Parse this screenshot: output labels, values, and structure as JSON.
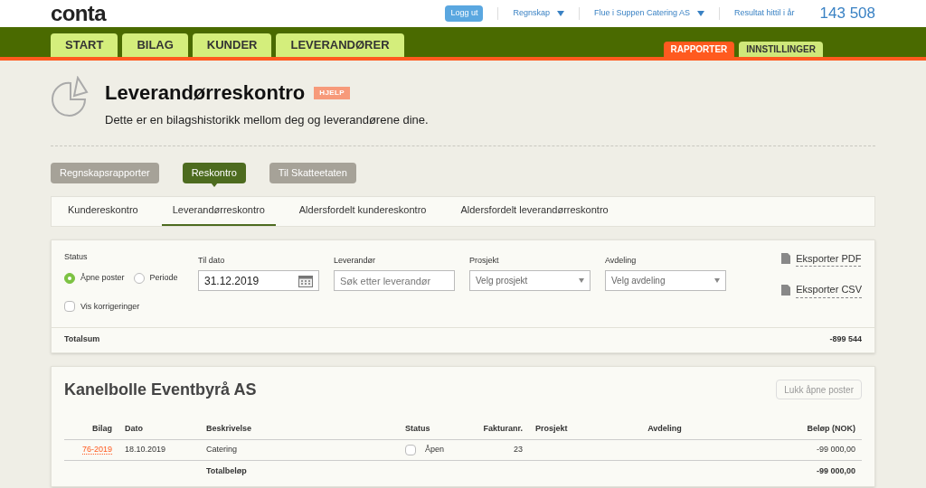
{
  "logo": "conta",
  "top_links": [
    {
      "label": "Logg ut",
      "kind": "button"
    },
    {
      "label": "Regnskap",
      "kind": "dropdown"
    },
    {
      "label": "Flue i Suppen Catering AS",
      "kind": "dropdown"
    },
    {
      "label": "Resultat hittil i år",
      "kind": "link"
    }
  ],
  "result_value": "143 508",
  "main_tabs": [
    {
      "label": "START"
    },
    {
      "label": "BILAG"
    },
    {
      "label": "KUNDER"
    },
    {
      "label": "LEVERANDØRER"
    }
  ],
  "right_tabs": [
    {
      "label": "RAPPORTER",
      "selected": true
    },
    {
      "label": "INNSTILLINGER",
      "selected": false
    }
  ],
  "page": {
    "title": "Leverandørreskontro",
    "help": "HJELP",
    "subtitle": "Dette er en bilagshistorikk mellom deg og leverandørene dine."
  },
  "sub_buttons": [
    {
      "label": "Regnskapsrapporter",
      "selected": false
    },
    {
      "label": "Reskontro",
      "selected": true
    },
    {
      "label": "Til Skatteetaten",
      "selected": false
    }
  ],
  "report_tabs": [
    {
      "label": "Kundereskontro",
      "selected": false
    },
    {
      "label": "Leverandørreskontro",
      "selected": true
    },
    {
      "label": "Aldersfordelt kundereskontro",
      "selected": false
    },
    {
      "label": "Aldersfordelt leverandørreskontro",
      "selected": false
    }
  ],
  "filters": {
    "status_label": "Status",
    "status_options": [
      {
        "label": "Åpne poster",
        "selected": true
      },
      {
        "label": "Periode",
        "selected": false
      }
    ],
    "show_corrections": {
      "label": "Vis korrigeringer",
      "checked": false
    },
    "date": {
      "label": "Til dato",
      "value": "31.12.2019"
    },
    "supplier": {
      "label": "Leverandør",
      "placeholder": "Søk etter leverandør"
    },
    "project": {
      "label": "Prosjekt",
      "placeholder": "Velg prosjekt"
    },
    "department": {
      "label": "Avdeling",
      "placeholder": "Velg avdeling"
    },
    "exports": [
      {
        "label": "Eksporter PDF"
      },
      {
        "label": "Eksporter CSV"
      }
    ],
    "total_label": "Totalsum",
    "total_value": "-899 544"
  },
  "supplier_card": {
    "name": "Kanelbolle Eventbyrå AS",
    "close_button": "Lukk åpne poster",
    "columns": [
      "Bilag",
      "Dato",
      "Beskrivelse",
      "Status",
      "Fakturanr.",
      "Prosjekt",
      "Avdeling",
      "Beløp (NOK)"
    ],
    "rows": [
      {
        "bilag": "76-2019",
        "dato": "18.10.2019",
        "beskrivelse": "Catering",
        "status": "Åpen",
        "checked": false,
        "fakturanr": "23",
        "belop": "-99 000,00"
      }
    ],
    "total_label": "Totalbeløp",
    "total_value": "-99 000,00"
  }
}
